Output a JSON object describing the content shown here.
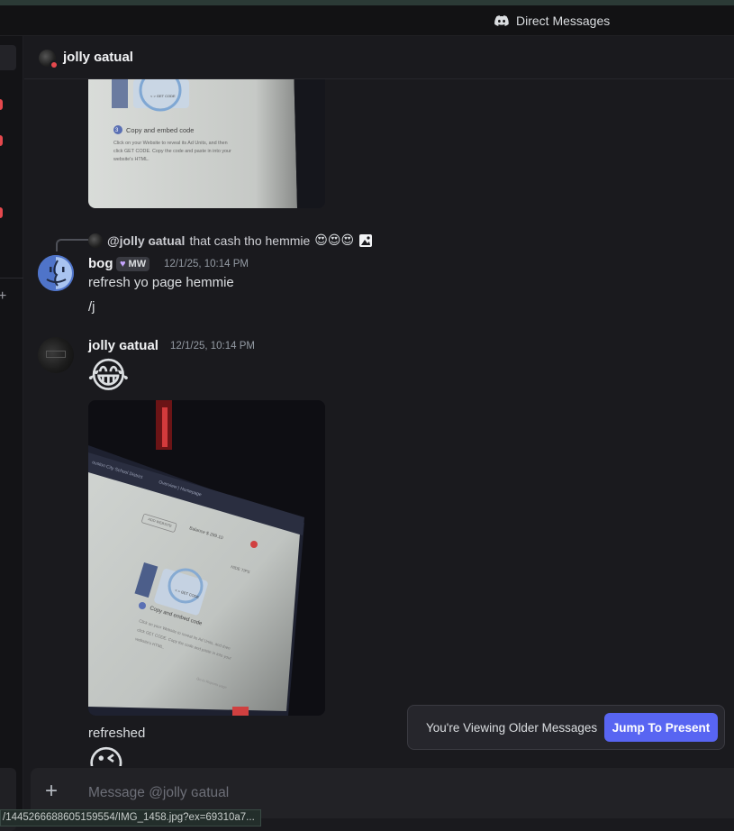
{
  "titlebar": {
    "title": "Direct Messages",
    "icon": "discord-icon"
  },
  "header": {
    "name": "jolly ɢatual",
    "status": "do-not-disturb"
  },
  "reply": {
    "author": "@jolly ɢatual",
    "text": "that cash tho hemmie",
    "emojis": "😍😍😍",
    "attachment_icon": "image-icon"
  },
  "messages": [
    {
      "author": "bog",
      "badge": "MW",
      "timestamp": "12/1/25, 10:14 PM",
      "lines": [
        "refresh yo page hemmie",
        "/j"
      ]
    },
    {
      "author": "jolly ɢatual",
      "timestamp": "12/1/25, 10:14 PM",
      "emoji_top": "😂",
      "caption": "refreshed",
      "emoji_bottom": "😉"
    }
  ],
  "image_text": {
    "step": "Copy and embed code",
    "desc1": "Click on your Website to reveal its Ad Units, and then",
    "desc2": "click GET CODE. Copy the code and paste in into your",
    "desc3": "website's HTML.",
    "get_code": "< > GET CODE"
  },
  "banner": {
    "text": "You're Viewing Older Messages",
    "button": "Jump To Present"
  },
  "composer": {
    "placeholder": "Message @jolly ɢatual"
  },
  "status_url": "/1445266688605159554/IMG_1458.jpg?ex=69310a7..."
}
